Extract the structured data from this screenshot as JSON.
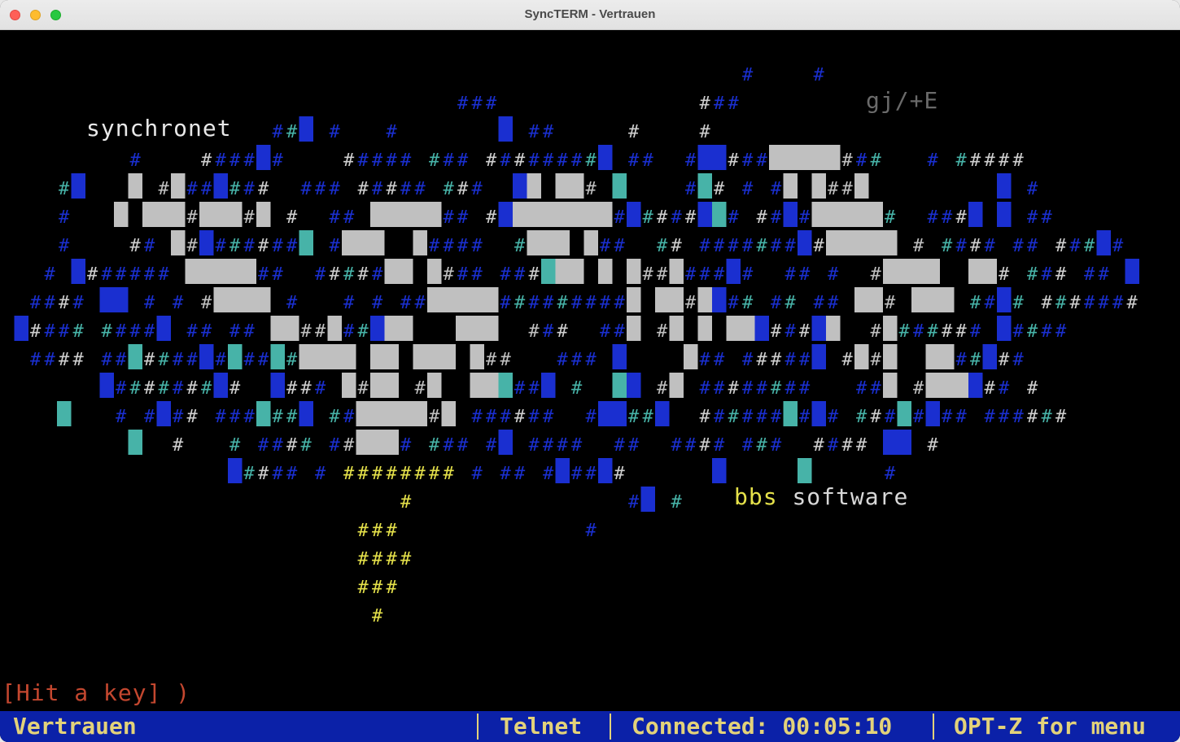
{
  "window": {
    "title": "SyncTERM - Vertrauen"
  },
  "terminal": {
    "art_text": {
      "synchronet": "synchronet",
      "bbs_software": "bbs software",
      "gj_e": "gj/+E"
    },
    "prompt": "[Hit a key] )"
  },
  "statusbar": {
    "bbs_name": "Vertrauen",
    "protocol": "Telnet",
    "connected": "Connected: 00:05:10",
    "menu_hint": "OPT-Z for menu"
  },
  "colors": {
    "terminal_bg": "#000000",
    "art_gray": "#c0c0c0",
    "art_blue": "#1a2fd0",
    "art_cyan": "#47b3a8",
    "art_yellow": "#e5e14a",
    "prompt_red": "#c4472f",
    "status_bg": "#0b21a8",
    "status_fg": "#e3d27a"
  },
  "icons": {
    "close": "close-icon",
    "minimize": "minimize-icon",
    "maximize": "maximize-icon"
  }
}
